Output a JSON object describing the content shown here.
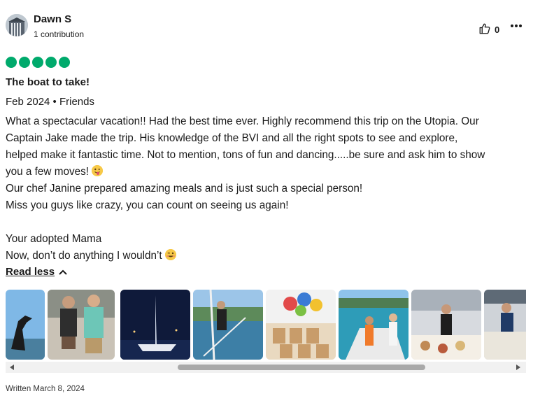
{
  "review": {
    "author": {
      "name": "Dawn S",
      "contributions": "1 contribution"
    },
    "helpful_count": "0",
    "rating": 5,
    "title": "The boat to take!",
    "visit": "Feb 2024 • Friends",
    "body_lines": [
      "What a spectacular vacation!! Had the best time ever. Highly recommend this trip on the Utopia. Our",
      "Captain Jake made the trip. His knowledge of the BVI and all the right spots to see and explore,",
      "helped make it fantastic time. Not to mention, tons of fun and dancing.....be sure and ask him to show",
      "you a few moves!",
      "Our chef Janine prepared amazing meals and is just such a special person!",
      "Miss you guys like crazy, you can count on seeing us again!",
      "",
      "Your adopted Mama",
      "Now, don’t do anything I wouldn’t"
    ],
    "read_less": "Read less",
    "written": "Written March 8, 2024"
  },
  "icons": {
    "helpful": "thumbs-up-icon",
    "more": "more-options-icon",
    "emoji_1": "tongue-wink-emoji",
    "emoji_2": "wink-emoji",
    "read_less": "chevron-up-icon"
  },
  "colors": {
    "rating_bubble": "#00aa6c",
    "text": "#1a1a1a"
  }
}
